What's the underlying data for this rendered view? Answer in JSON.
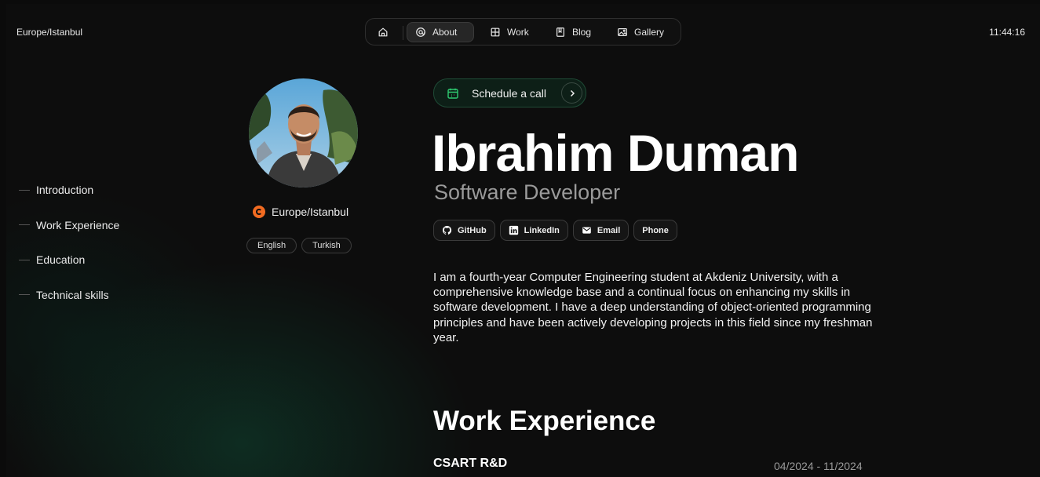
{
  "header": {
    "timezone": "Europe/Istanbul",
    "clock": "11:44:16"
  },
  "nav": {
    "home_icon": "home-icon",
    "items": [
      {
        "label": "About",
        "icon": "at-circle-icon",
        "active": true
      },
      {
        "label": "Work",
        "icon": "grid-icon"
      },
      {
        "label": "Blog",
        "icon": "book-icon"
      },
      {
        "label": "Gallery",
        "icon": "image-icon"
      }
    ]
  },
  "toc": {
    "items": [
      "Introduction",
      "Work Experience",
      "Education",
      "Technical skills"
    ]
  },
  "profile": {
    "location": "Europe/Istanbul",
    "languages": [
      "English",
      "Turkish"
    ]
  },
  "hero": {
    "schedule_label": "Schedule a call",
    "name": "Ibrahim Duman",
    "role": "Software Developer",
    "socials": [
      {
        "label": "GitHub",
        "icon": "github-icon"
      },
      {
        "label": "LinkedIn",
        "icon": "linkedin-icon"
      },
      {
        "label": "Email",
        "icon": "mail-icon"
      },
      {
        "label": "Phone",
        "icon": ""
      }
    ],
    "bio": "I am a fourth-year Computer Engineering student at Akdeniz University, with a comprehensive knowledge base and a continual focus on enhancing my skills in software development. I have a deep understanding of object-oriented programming principles and have been actively developing projects in this field since my freshman year."
  },
  "work": {
    "heading": "Work Experience",
    "entries": [
      {
        "company": "CSART R&D",
        "dates": "04/2024 - 11/2024"
      }
    ]
  },
  "colors": {
    "accent_green": "#1f4b36",
    "location_orange": "#f26b21",
    "background": "#0d0d0d"
  }
}
